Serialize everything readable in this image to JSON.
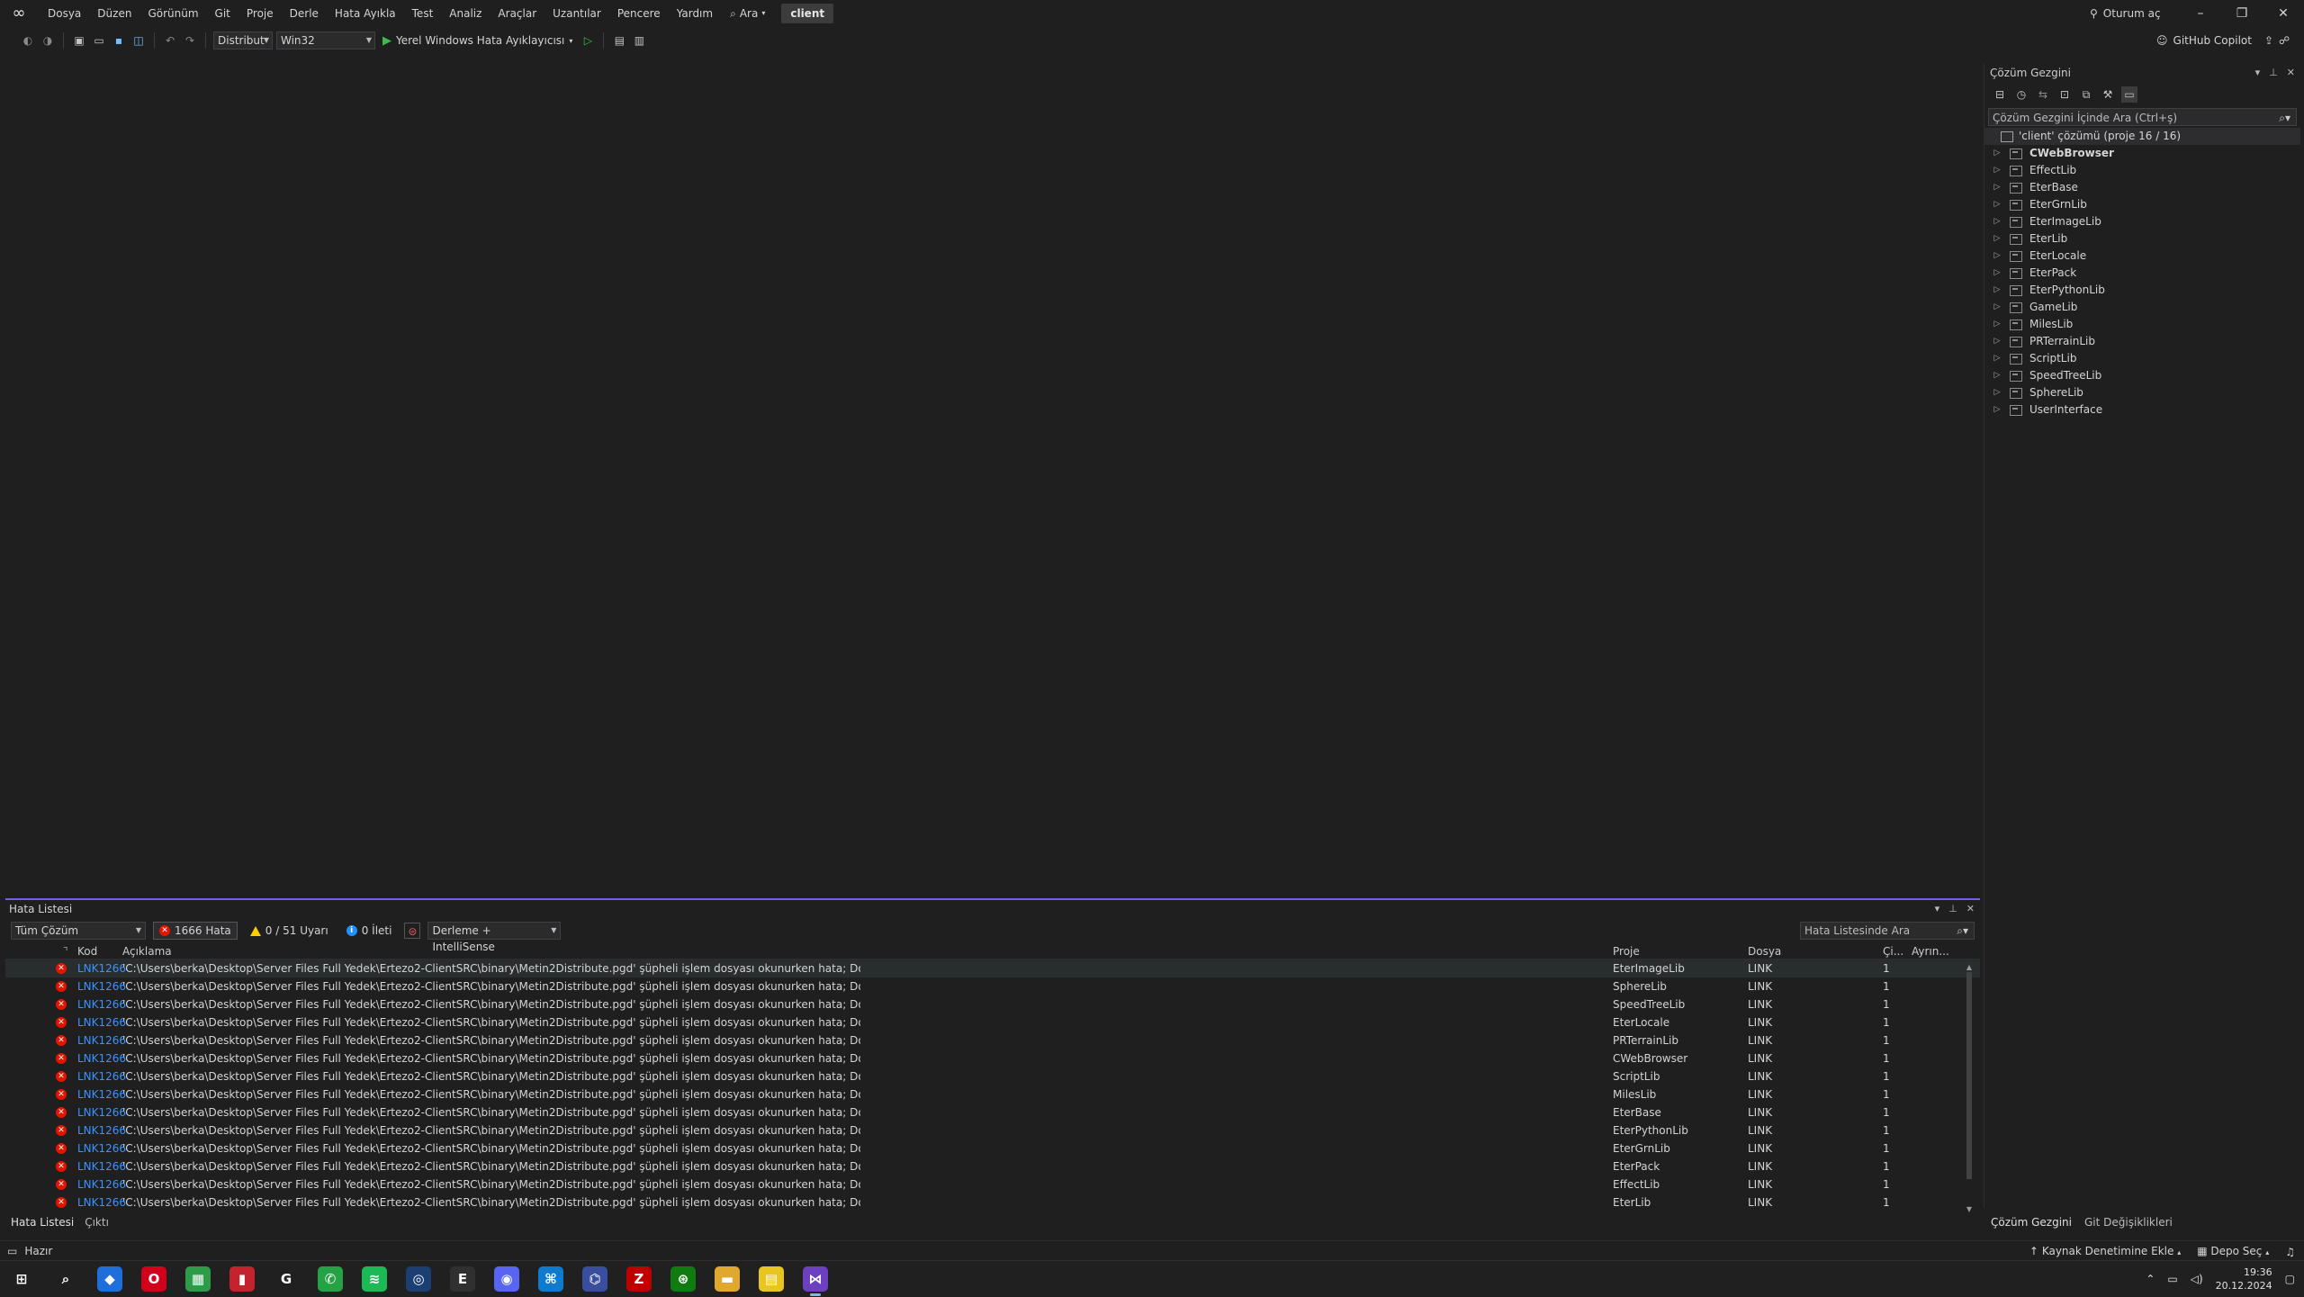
{
  "menu": {
    "items": [
      "Dosya",
      "Düzen",
      "Görünüm",
      "Git",
      "Proje",
      "Derle",
      "Hata Ayıkla",
      "Test",
      "Analiz",
      "Araçlar",
      "Uzantılar",
      "Pencere",
      "Yardım"
    ],
    "search_label": "Ara",
    "solution_name": "client",
    "sign_in": "Oturum aç"
  },
  "toolbar": {
    "configuration": "Distribut",
    "platform": "Win32",
    "run_label": "Yerel Windows Hata Ayıklayıcısı",
    "copilot_label": "GitHub Copilot"
  },
  "solution_explorer": {
    "title": "Çözüm Gezgini",
    "search_placeholder": "Çözüm Gezgini İçinde Ara (Ctrl+ş)",
    "solution_label": "'client' çözümü (proje 16 / 16)",
    "projects": [
      {
        "name": "CWebBrowser",
        "bold": true
      },
      {
        "name": "EffectLib"
      },
      {
        "name": "EterBase"
      },
      {
        "name": "EterGrnLib"
      },
      {
        "name": "EterImageLib"
      },
      {
        "name": "EterLib"
      },
      {
        "name": "EterLocale"
      },
      {
        "name": "EterPack"
      },
      {
        "name": "EterPythonLib"
      },
      {
        "name": "GameLib"
      },
      {
        "name": "MilesLib"
      },
      {
        "name": "PRTerrainLib"
      },
      {
        "name": "ScriptLib"
      },
      {
        "name": "SpeedTreeLib"
      },
      {
        "name": "SphereLib"
      },
      {
        "name": "UserInterface"
      }
    ],
    "bottom_tabs": [
      "Çözüm Gezgini",
      "Git Değişiklikleri"
    ]
  },
  "error_list": {
    "title": "Hata Listesi",
    "scope": "Tüm Çözüm",
    "errors_label": "1666 Hata",
    "warnings_label": "0 / 51 Uyarı",
    "messages_label": "0 İleti",
    "build_filter": "Derleme + IntelliSense",
    "search_placeholder": "Hata Listesinde Ara",
    "columns": {
      "code": "Kod",
      "description": "Açıklama",
      "project": "Proje",
      "file": "Dosya",
      "line": "Çi...",
      "suppression": "Ayrın..."
    },
    "rows": [
      {
        "code": "LNK1266",
        "description": "'C:\\Users\\berka\\Desktop\\Server Files Full Yedek\\Ertezo2-ClientSRC\\binary\\Metin2Distribute.pgd' şüpheli işlem dosyası okunurken hata; Dosya bulunamadı",
        "project": "EterImageLib",
        "file": "LINK",
        "line": "1"
      },
      {
        "code": "LNK1266",
        "description": "'C:\\Users\\berka\\Desktop\\Server Files Full Yedek\\Ertezo2-ClientSRC\\binary\\Metin2Distribute.pgd' şüpheli işlem dosyası okunurken hata; Dosya bulunamadı",
        "project": "SphereLib",
        "file": "LINK",
        "line": "1"
      },
      {
        "code": "LNK1266",
        "description": "'C:\\Users\\berka\\Desktop\\Server Files Full Yedek\\Ertezo2-ClientSRC\\binary\\Metin2Distribute.pgd' şüpheli işlem dosyası okunurken hata; Dosya bulunamadı",
        "project": "SpeedTreeLib",
        "file": "LINK",
        "line": "1"
      },
      {
        "code": "LNK1266",
        "description": "'C:\\Users\\berka\\Desktop\\Server Files Full Yedek\\Ertezo2-ClientSRC\\binary\\Metin2Distribute.pgd' şüpheli işlem dosyası okunurken hata; Dosya bulunamadı",
        "project": "EterLocale",
        "file": "LINK",
        "line": "1"
      },
      {
        "code": "LNK1266",
        "description": "'C:\\Users\\berka\\Desktop\\Server Files Full Yedek\\Ertezo2-ClientSRC\\binary\\Metin2Distribute.pgd' şüpheli işlem dosyası okunurken hata; Dosya bulunamadı",
        "project": "PRTerrainLib",
        "file": "LINK",
        "line": "1"
      },
      {
        "code": "LNK1266",
        "description": "'C:\\Users\\berka\\Desktop\\Server Files Full Yedek\\Ertezo2-ClientSRC\\binary\\Metin2Distribute.pgd' şüpheli işlem dosyası okunurken hata; Dosya bulunamadı",
        "project": "CWebBrowser",
        "file": "LINK",
        "line": "1"
      },
      {
        "code": "LNK1266",
        "description": "'C:\\Users\\berka\\Desktop\\Server Files Full Yedek\\Ertezo2-ClientSRC\\binary\\Metin2Distribute.pgd' şüpheli işlem dosyası okunurken hata; Dosya bulunamadı",
        "project": "ScriptLib",
        "file": "LINK",
        "line": "1"
      },
      {
        "code": "LNK1266",
        "description": "'C:\\Users\\berka\\Desktop\\Server Files Full Yedek\\Ertezo2-ClientSRC\\binary\\Metin2Distribute.pgd' şüpheli işlem dosyası okunurken hata; Dosya bulunamadı",
        "project": "MilesLib",
        "file": "LINK",
        "line": "1"
      },
      {
        "code": "LNK1266",
        "description": "'C:\\Users\\berka\\Desktop\\Server Files Full Yedek\\Ertezo2-ClientSRC\\binary\\Metin2Distribute.pgd' şüpheli işlem dosyası okunurken hata; Dosya bulunamadı",
        "project": "EterBase",
        "file": "LINK",
        "line": "1"
      },
      {
        "code": "LNK1266",
        "description": "'C:\\Users\\berka\\Desktop\\Server Files Full Yedek\\Ertezo2-ClientSRC\\binary\\Metin2Distribute.pgd' şüpheli işlem dosyası okunurken hata; Dosya bulunamadı",
        "project": "EterPythonLib",
        "file": "LINK",
        "line": "1"
      },
      {
        "code": "LNK1266",
        "description": "'C:\\Users\\berka\\Desktop\\Server Files Full Yedek\\Ertezo2-ClientSRC\\binary\\Metin2Distribute.pgd' şüpheli işlem dosyası okunurken hata; Dosya bulunamadı",
        "project": "EterGrnLib",
        "file": "LINK",
        "line": "1"
      },
      {
        "code": "LNK1266",
        "description": "'C:\\Users\\berka\\Desktop\\Server Files Full Yedek\\Ertezo2-ClientSRC\\binary\\Metin2Distribute.pgd' şüpheli işlem dosyası okunurken hata; Dosya bulunamadı",
        "project": "EterPack",
        "file": "LINK",
        "line": "1"
      },
      {
        "code": "LNK1266",
        "description": "'C:\\Users\\berka\\Desktop\\Server Files Full Yedek\\Ertezo2-ClientSRC\\binary\\Metin2Distribute.pgd' şüpheli işlem dosyası okunurken hata; Dosya bulunamadı",
        "project": "EffectLib",
        "file": "LINK",
        "line": "1"
      },
      {
        "code": "LNK1266",
        "description": "'C:\\Users\\berka\\Desktop\\Server Files Full Yedek\\Ertezo2-ClientSRC\\binary\\Metin2Distribute.pgd' şüpheli işlem dosyası okunurken hata; Dosya bulunamadı",
        "project": "EterLib",
        "file": "LINK",
        "line": "1"
      }
    ],
    "bottom_tabs": [
      "Hata Listesi",
      "Çıktı"
    ]
  },
  "status_bar": {
    "ready": "Hazır",
    "add_source_control": "Kaynak Denetimine Ekle",
    "select_repo": "Depo Seç"
  },
  "taskbar": {
    "time": "19:36",
    "date": "20.12.2024",
    "apps": [
      {
        "icon": "windows-start-icon",
        "glyph": "⊞",
        "color": "#202020"
      },
      {
        "icon": "search-icon",
        "glyph": "⌕",
        "color": "#202020"
      },
      {
        "icon": "browser-icon",
        "glyph": "◆",
        "color": "#1e6fd9"
      },
      {
        "icon": "opera-icon",
        "glyph": "O",
        "color": "#d3001b"
      },
      {
        "icon": "sheets-icon",
        "glyph": "▦",
        "color": "#2e9b48"
      },
      {
        "icon": "red-app-icon",
        "glyph": "▮",
        "color": "#c4222c"
      },
      {
        "icon": "github-desktop-icon",
        "glyph": "G",
        "color": "#202020"
      },
      {
        "icon": "whatsapp-icon",
        "glyph": "✆",
        "color": "#25a244"
      },
      {
        "icon": "spotify-icon",
        "glyph": "≋",
        "color": "#1db954"
      },
      {
        "icon": "steam-icon",
        "glyph": "◎",
        "color": "#1b3f73"
      },
      {
        "icon": "epic-games-icon",
        "glyph": "E",
        "color": "#303030"
      },
      {
        "icon": "discord-icon",
        "glyph": "◉",
        "color": "#5865f2"
      },
      {
        "icon": "vscode-icon",
        "glyph": "⌘",
        "color": "#0e7bcf"
      },
      {
        "icon": "network-app-icon",
        "glyph": "⌬",
        "color": "#3a4ea0"
      },
      {
        "icon": "filezilla-icon",
        "glyph": "Z",
        "color": "#bf0000"
      },
      {
        "icon": "xbox-icon",
        "glyph": "⊛",
        "color": "#107c10"
      },
      {
        "icon": "file-explorer-icon",
        "glyph": "▬",
        "color": "#e0a82e"
      },
      {
        "icon": "sticky-notes-icon",
        "glyph": "▤",
        "color": "#e8c51f"
      },
      {
        "icon": "visual-studio-icon",
        "glyph": "⋈",
        "color": "#6c40bf"
      }
    ]
  },
  "colors": {
    "accent": "#7160e8",
    "error": "#e51400",
    "warning": "#ffcc00",
    "info": "#1e90ff",
    "link": "#3794ff"
  }
}
